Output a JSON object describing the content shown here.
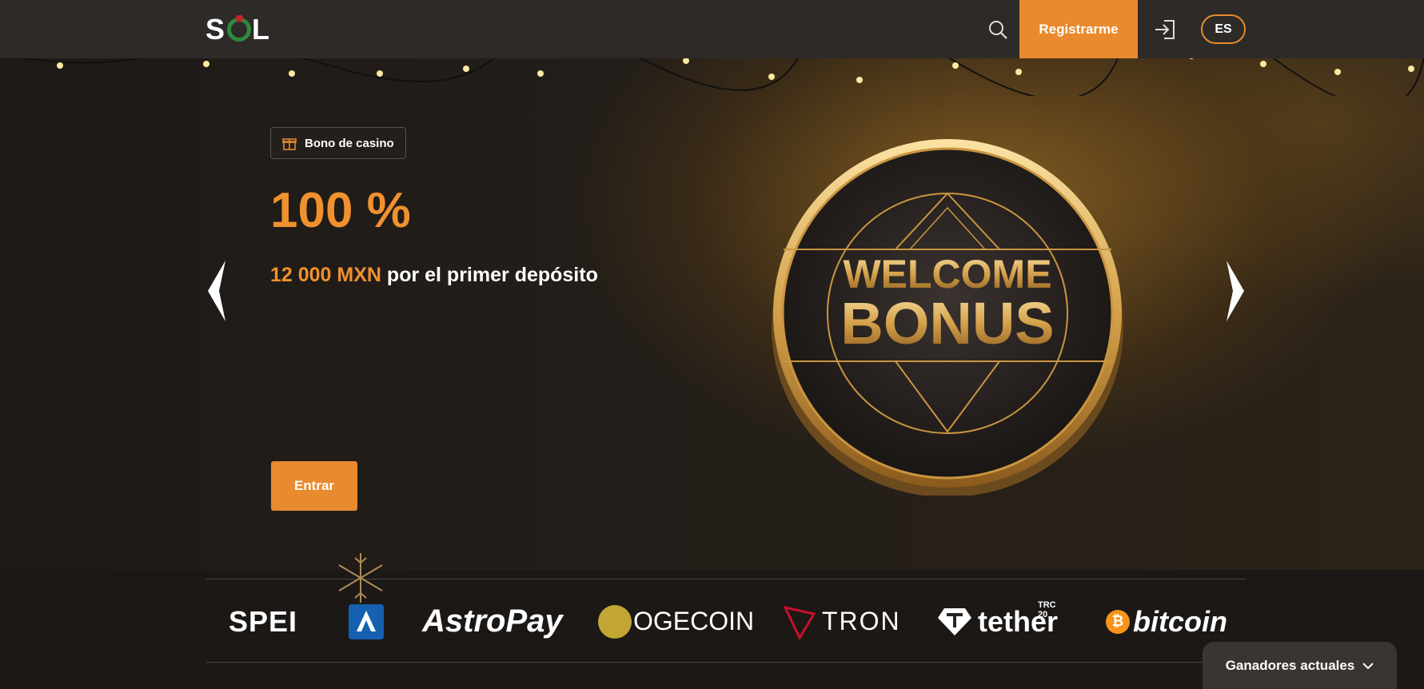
{
  "header": {
    "logo": "SOL",
    "register_label": "Registrarme",
    "language": "ES"
  },
  "hero": {
    "badge": "Bono de casino",
    "headline": "100 %",
    "amount": "12 000 MXN",
    "subtitle": "por el primer depósito",
    "cta_label": "Entrar",
    "banner_line1": "WELCOME",
    "banner_line2": "BONUS"
  },
  "payments": {
    "spei": "SPEI",
    "astropay": "AstroPay",
    "dogecoin": "OGECOIN",
    "tron": "TRON",
    "tether": "tether",
    "tether_tag": "TRC 20",
    "bitcoin": "bitcoin"
  },
  "winners_label": "Ganadores actuales",
  "colors": {
    "accent": "#e88a2e",
    "header_bg": "#2d2a28",
    "tron_red": "#c8102e",
    "bitcoin_orange": "#f7931a"
  },
  "icons": [
    "search-icon",
    "login-icon",
    "gift-icon",
    "chevron-left-icon",
    "chevron-right-icon",
    "chevron-down-icon",
    "snowflake-icon"
  ]
}
